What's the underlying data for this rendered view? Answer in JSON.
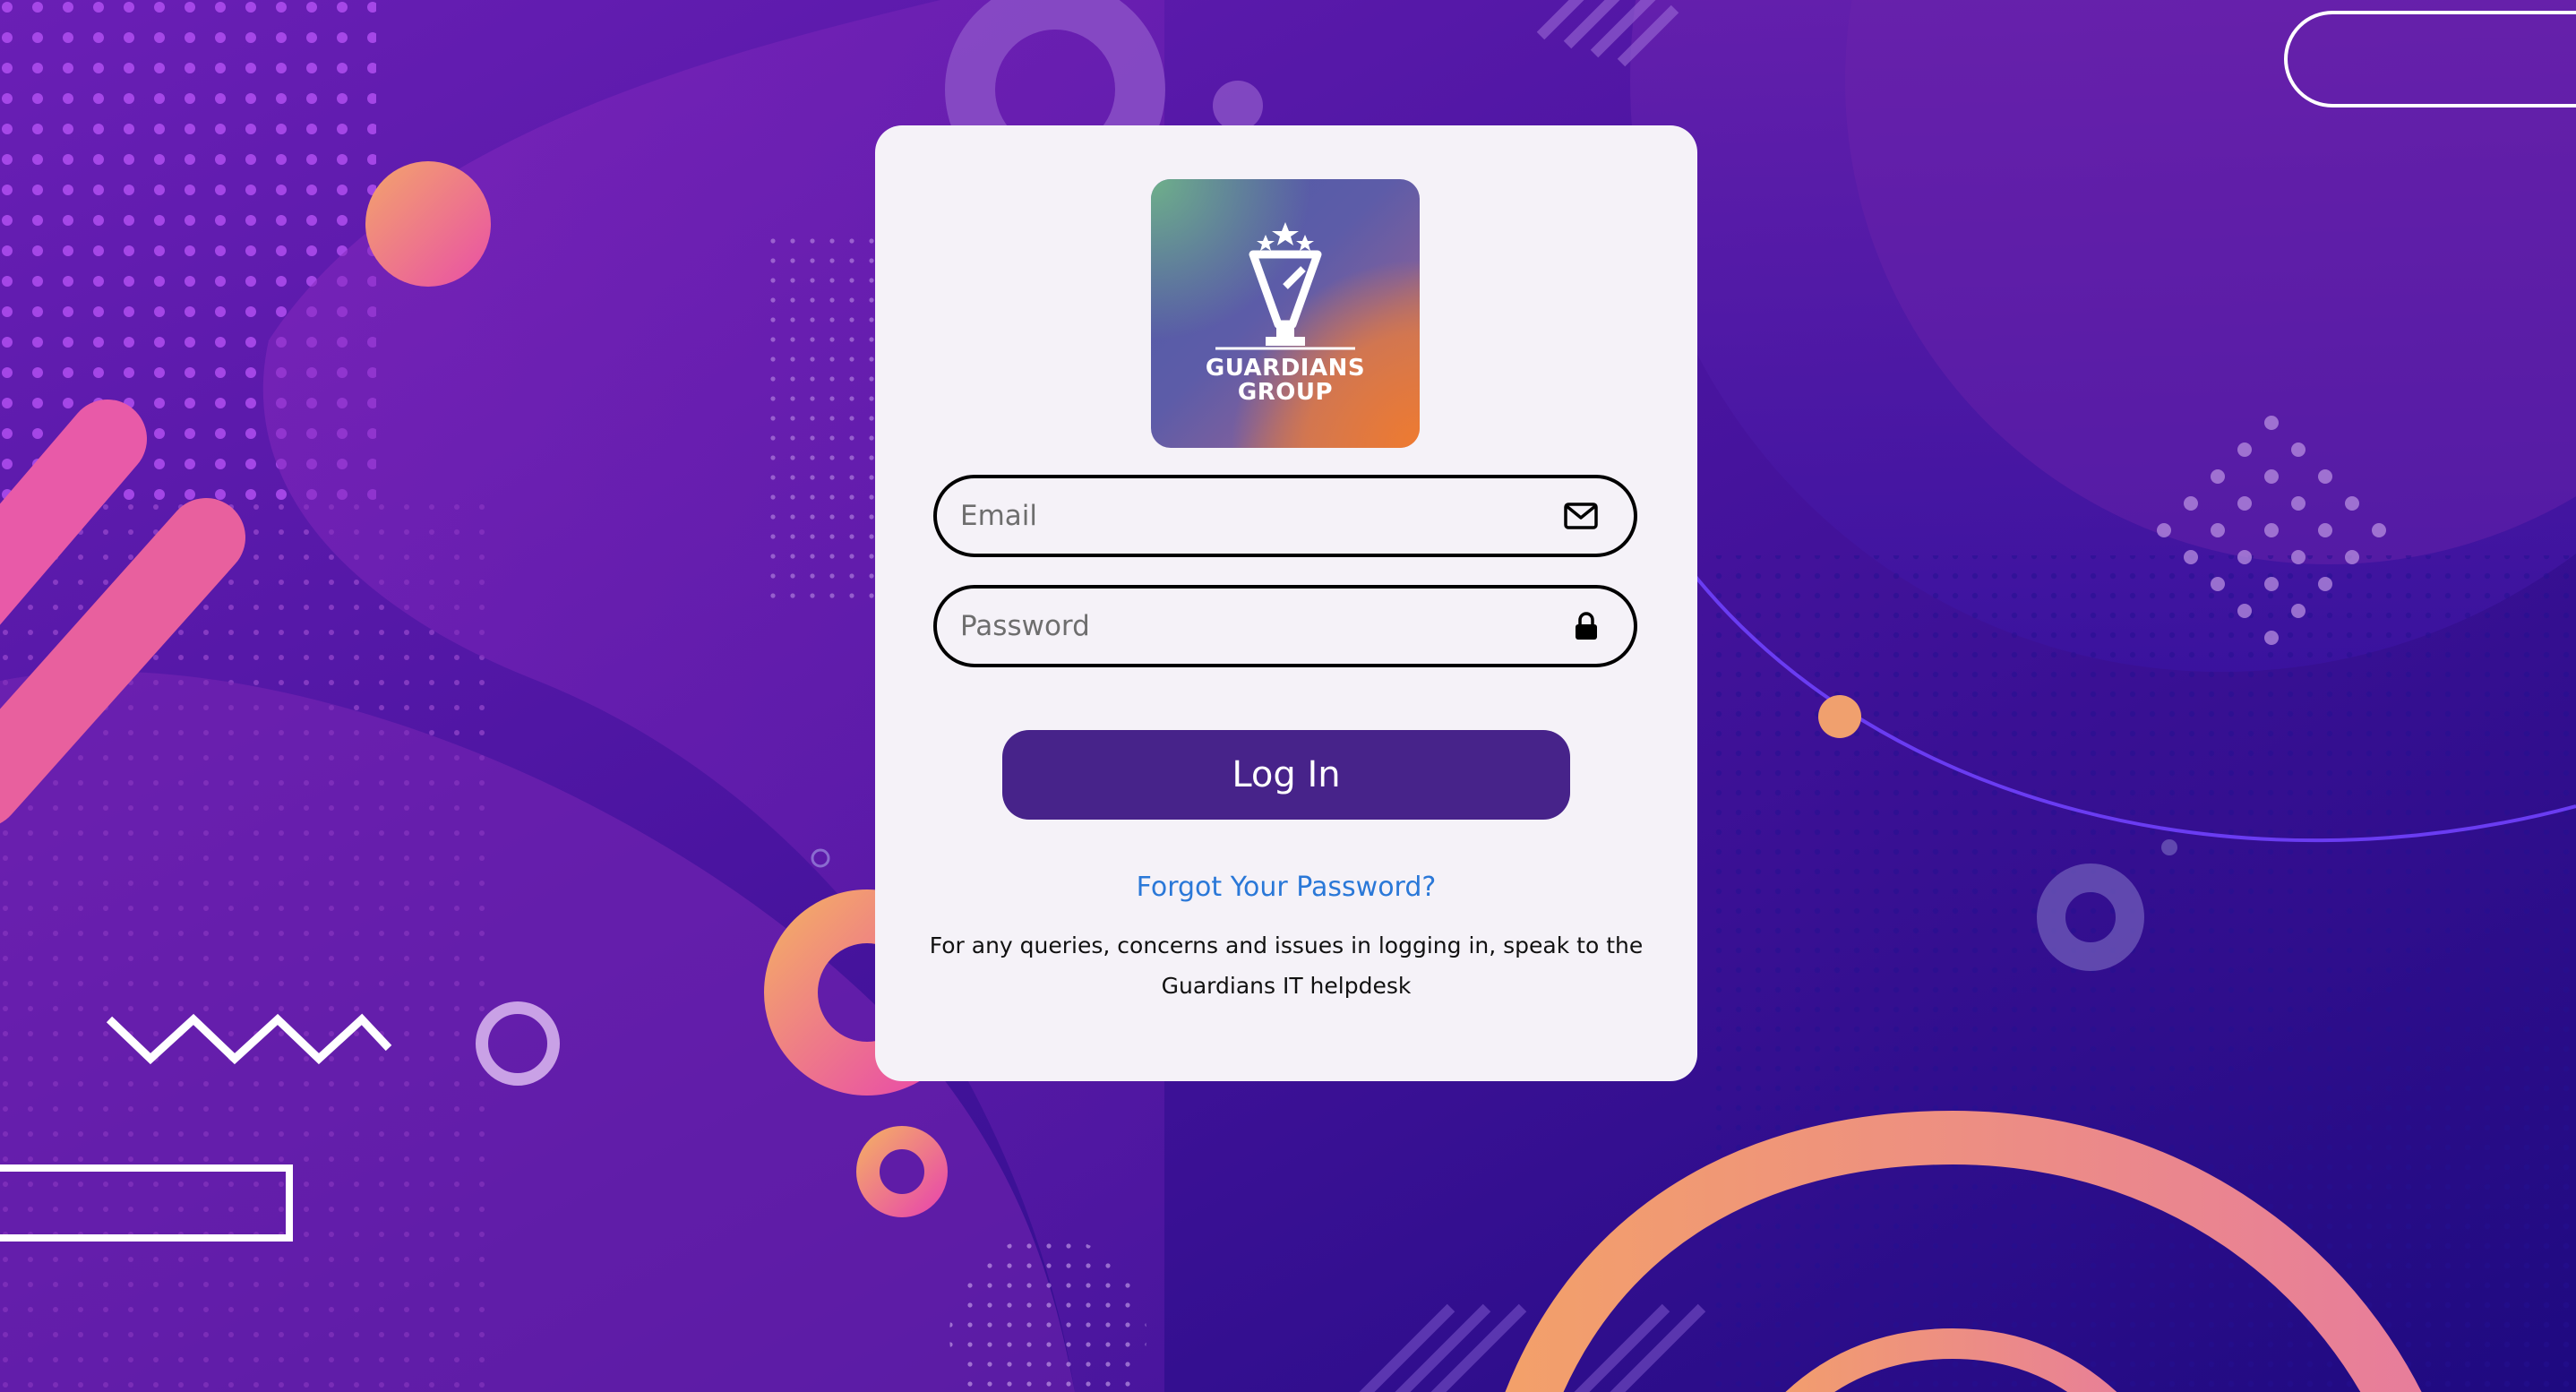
{
  "logo": {
    "line1": "GUARDIANS",
    "line2": "GROUP"
  },
  "form": {
    "email_placeholder": "Email",
    "password_placeholder": "Password",
    "login_label": "Log In",
    "forgot_label": "Forgot Your Password?",
    "help_text": "For any queries, concerns and issues in logging in, speak to the Guardians IT helpdesk"
  },
  "icons": {
    "email": "envelope-icon",
    "password": "lock-icon"
  },
  "colors": {
    "background": "#3b118f",
    "card": "#f5f2f8",
    "button": "#47238a",
    "link": "#2a78d8",
    "accent_pink": "#e8559f",
    "accent_orange": "#f3a06a"
  }
}
